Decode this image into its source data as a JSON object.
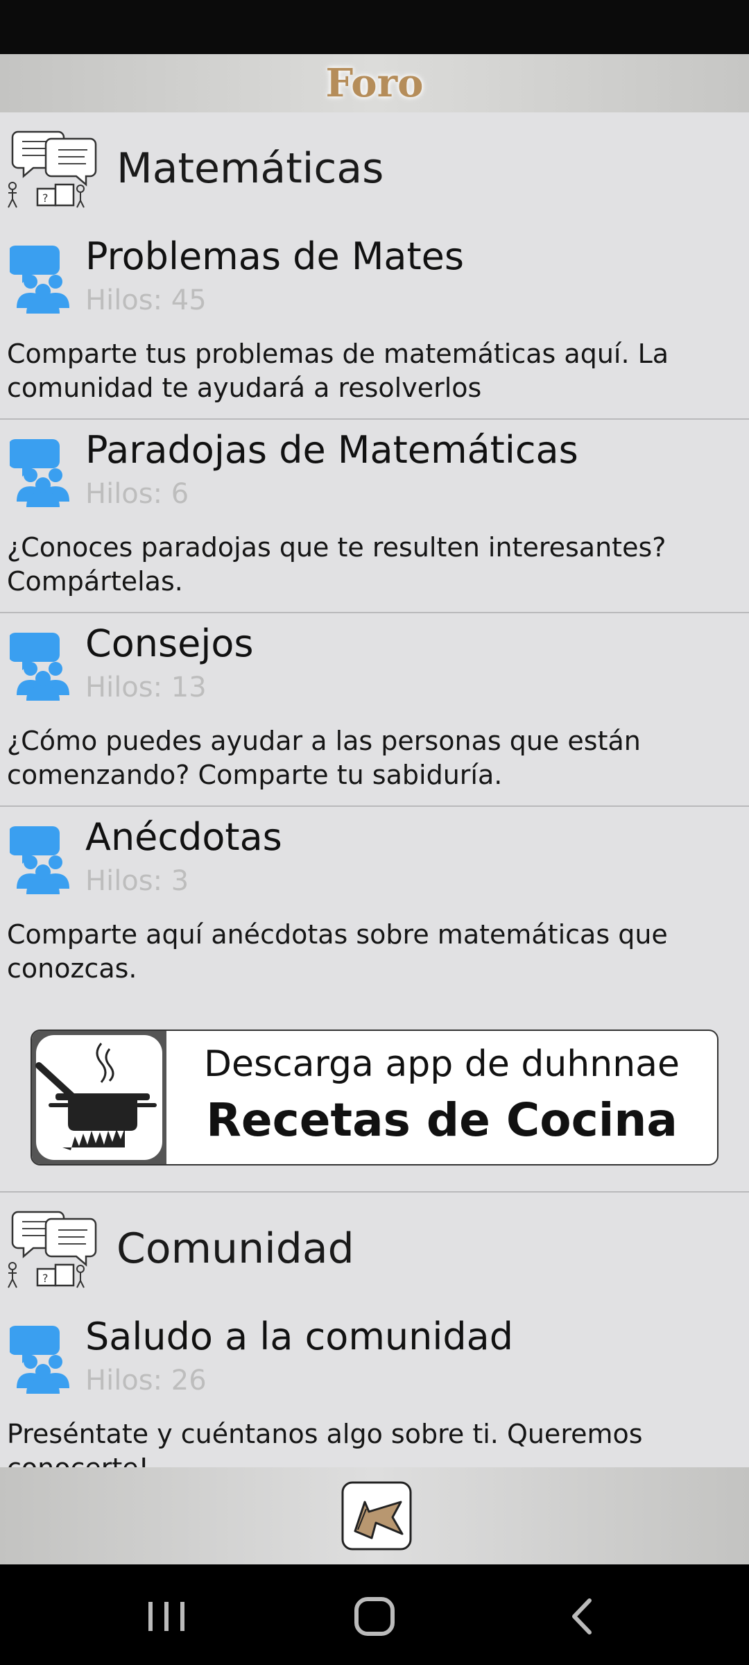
{
  "header": {
    "title": "Foro"
  },
  "sections": [
    {
      "category": "Matemáticas",
      "forums": [
        {
          "title": "Problemas de Mates",
          "threads": "Hilos: 45",
          "description": "Comparte tus problemas de matemáticas aquí. La comunidad te ayudará a resolverlos"
        },
        {
          "title": "Paradojas de Matemáticas",
          "threads": "Hilos: 6",
          "description": "¿Conoces paradojas que te resulten interesantes? Compártelas."
        },
        {
          "title": "Consejos",
          "threads": "Hilos: 13",
          "description": "¿Cómo puedes ayudar a las personas que están comenzando? Comparte tu sabiduría."
        },
        {
          "title": "Anécdotas",
          "threads": "Hilos: 3",
          "description": "Comparte aquí anécdotas sobre matemáticas que conozcas."
        }
      ]
    },
    {
      "category": "Comunidad",
      "forums": [
        {
          "title": "Saludo a la comunidad",
          "threads": "Hilos: 26",
          "description": "Preséntate y cuéntanos algo sobre ti. Queremos conocerte!"
        }
      ]
    }
  ],
  "ad": {
    "line1": "Descarga app de duhnnae",
    "line2": "Recetas de Cocina"
  },
  "icons": {
    "category": "speech-bubbles-sketch-icon",
    "forum": "people-group-chat-icon",
    "back": "double-arrow-back-icon",
    "ad": "cooking-pot-icon"
  },
  "colors": {
    "accent_title": "#b58d5a",
    "forum_icon": "#3a9ff0",
    "threads_text": "#bdbdbd"
  }
}
